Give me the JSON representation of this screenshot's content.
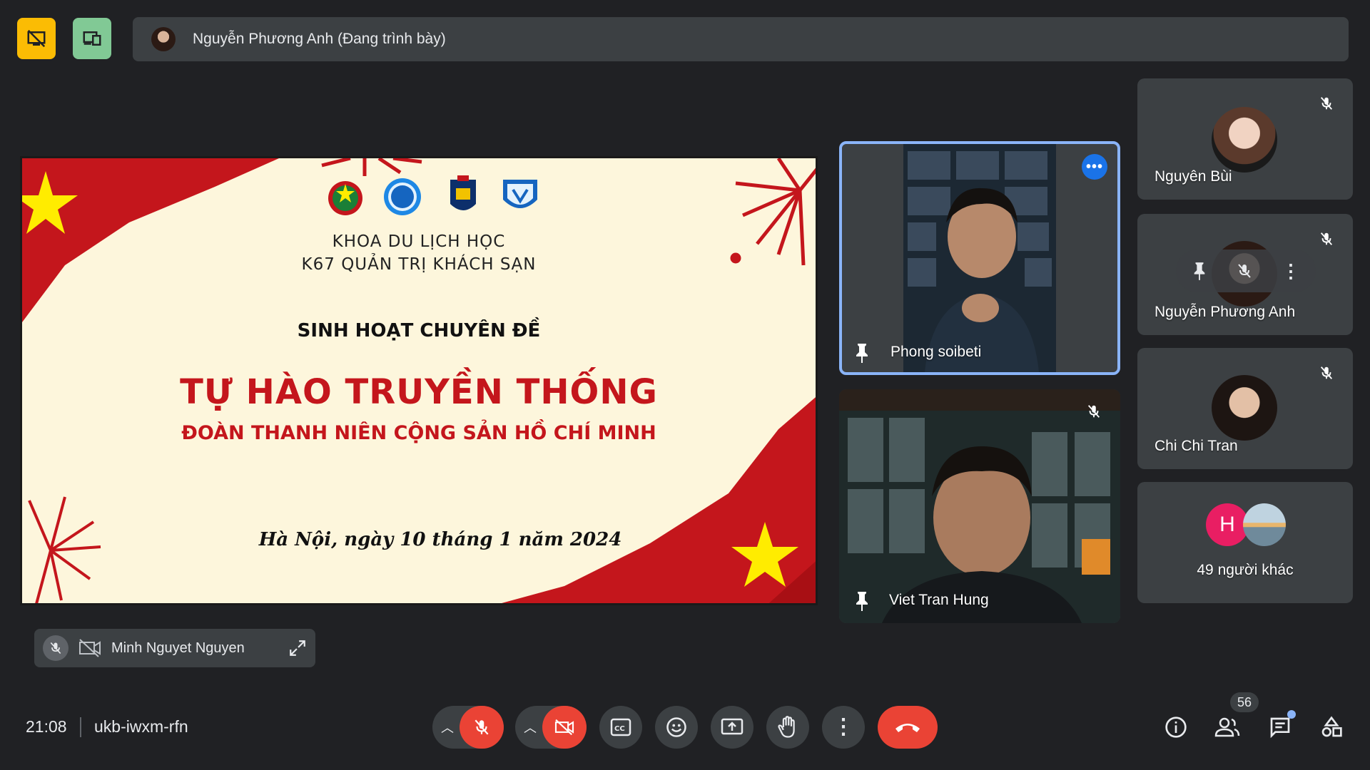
{
  "topbar": {
    "stop_present_icon": "stop-presenting-icon",
    "layout_icon": "devices-layout-icon",
    "presenter_label": "Nguyễn Phương Anh (Đang trình bày)"
  },
  "slide": {
    "faculty": "KHOA DU LỊCH HỌC",
    "class": "K67 QUẢN TRỊ KHÁCH SẠN",
    "event": "SINH HOẠT CHUYÊN ĐỀ",
    "title": "TỰ HÀO TRUYỀN THỐNG",
    "subtitle": "ĐOÀN THANH NIÊN CỘNG SẢN HỒ CHÍ MINH",
    "date": "Hà Nội, ngày 10 tháng 1 năm 2024",
    "colors": {
      "red": "#c4161c",
      "yellow": "#ffec00",
      "background": "#fdf6dc"
    }
  },
  "tiles": {
    "phong": {
      "name": "Phong soibeti",
      "pinned": true,
      "more_icon": "more-options-icon"
    },
    "viet": {
      "name": "Viet Tran Hung",
      "pinned": true,
      "muted": true
    }
  },
  "side_tiles": [
    {
      "name": "Nguyên Bùi",
      "muted": true
    },
    {
      "name": "Nguyễn Phương Anh",
      "muted": true
    },
    {
      "name": "Chi Chi Tran",
      "muted": true
    },
    {
      "name": "49 người khác",
      "initial": "H"
    }
  ],
  "self_chip": {
    "name": "Minh Nguyet Nguyen"
  },
  "bottombar": {
    "time": "21:08",
    "meeting_code": "ukb-iwxm-rfn",
    "participants_count": "56",
    "accent_red": "#ea4335"
  }
}
